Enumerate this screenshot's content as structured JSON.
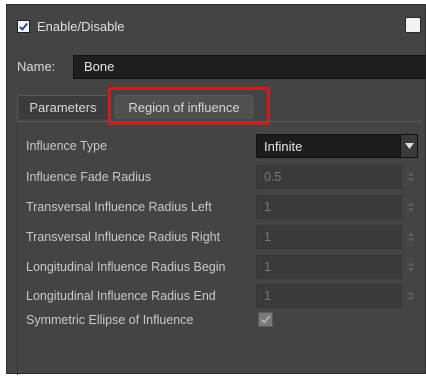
{
  "header": {
    "enable_label": "Enable/Disable",
    "enable_checked": true,
    "swatch_color": "#f2f2f2"
  },
  "name_row": {
    "label": "Name:",
    "value": "Bone"
  },
  "tabs": [
    {
      "label": "Parameters",
      "active": false
    },
    {
      "label": "Region of influence",
      "active": true
    }
  ],
  "highlight_color": "#d11a1a",
  "fields": {
    "influence_type": {
      "label": "Influence Type",
      "value": "Infinite",
      "icon": "chevron-down-icon"
    },
    "fade_radius": {
      "label": "Influence Fade Radius",
      "value": "0.5"
    },
    "trans_left": {
      "label": "Transversal Influence Radius Left",
      "value": "1"
    },
    "trans_right": {
      "label": "Transversal Influence Radius Right",
      "value": "1"
    },
    "long_begin": {
      "label": "Longitudinal Influence Radius Begin",
      "value": "1"
    },
    "long_end": {
      "label": "Longitudinal Influence Radius End",
      "value": "1"
    },
    "symmetric": {
      "label": "Symmetric Ellipse of Influence",
      "checked": true
    }
  }
}
